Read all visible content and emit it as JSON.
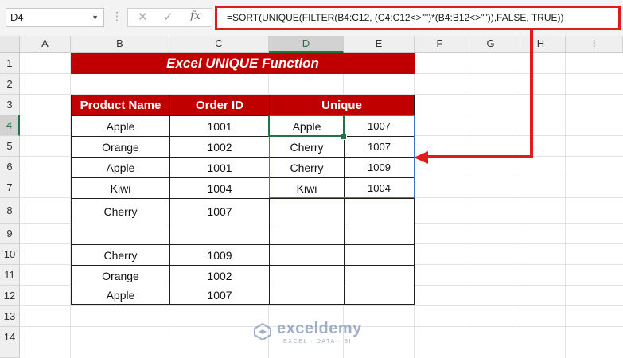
{
  "formula_bar": {
    "name_box": "D4",
    "cancel_icon": "✕",
    "enter_icon": "✓",
    "fx_label": "fx",
    "formula": "=SORT(UNIQUE(FILTER(B4:C12, (C4:C12<>\"\")*(B4:B12<>\"\")),FALSE, TRUE))"
  },
  "columns": [
    "A",
    "B",
    "C",
    "D",
    "E",
    "F",
    "G",
    "H",
    "I"
  ],
  "rows": [
    "1",
    "2",
    "3",
    "4",
    "5",
    "6",
    "7",
    "8",
    "9",
    "10",
    "11",
    "12",
    "13",
    "14"
  ],
  "sheet": {
    "title": "Excel UNIQUE Function",
    "headers": {
      "product_name": "Product Name",
      "order_id": "Order ID",
      "unique": "Unique"
    },
    "source": [
      {
        "product": "Apple",
        "order": "1001"
      },
      {
        "product": "Orange",
        "order": "1002"
      },
      {
        "product": "Apple",
        "order": "1001"
      },
      {
        "product": "Kiwi",
        "order": "1004"
      },
      {
        "product": "Cherry",
        "order": "1007"
      },
      {
        "product": "",
        "order": ""
      },
      {
        "product": "Cherry",
        "order": "1009"
      },
      {
        "product": "Orange",
        "order": "1002"
      },
      {
        "product": "Apple",
        "order": "1007"
      }
    ],
    "unique": [
      {
        "product": "Apple",
        "order": "1007"
      },
      {
        "product": "Cherry",
        "order": "1007"
      },
      {
        "product": "Cherry",
        "order": "1009"
      },
      {
        "product": "Kiwi",
        "order": "1004"
      }
    ]
  },
  "watermark": {
    "name": "exceldemy",
    "tagline": "EXCEL · DATA · BI"
  },
  "colors": {
    "header_red": "#c00000",
    "excel_green": "#217346",
    "callout_red": "#e01b1b",
    "selection_blue": "#4472c4"
  }
}
